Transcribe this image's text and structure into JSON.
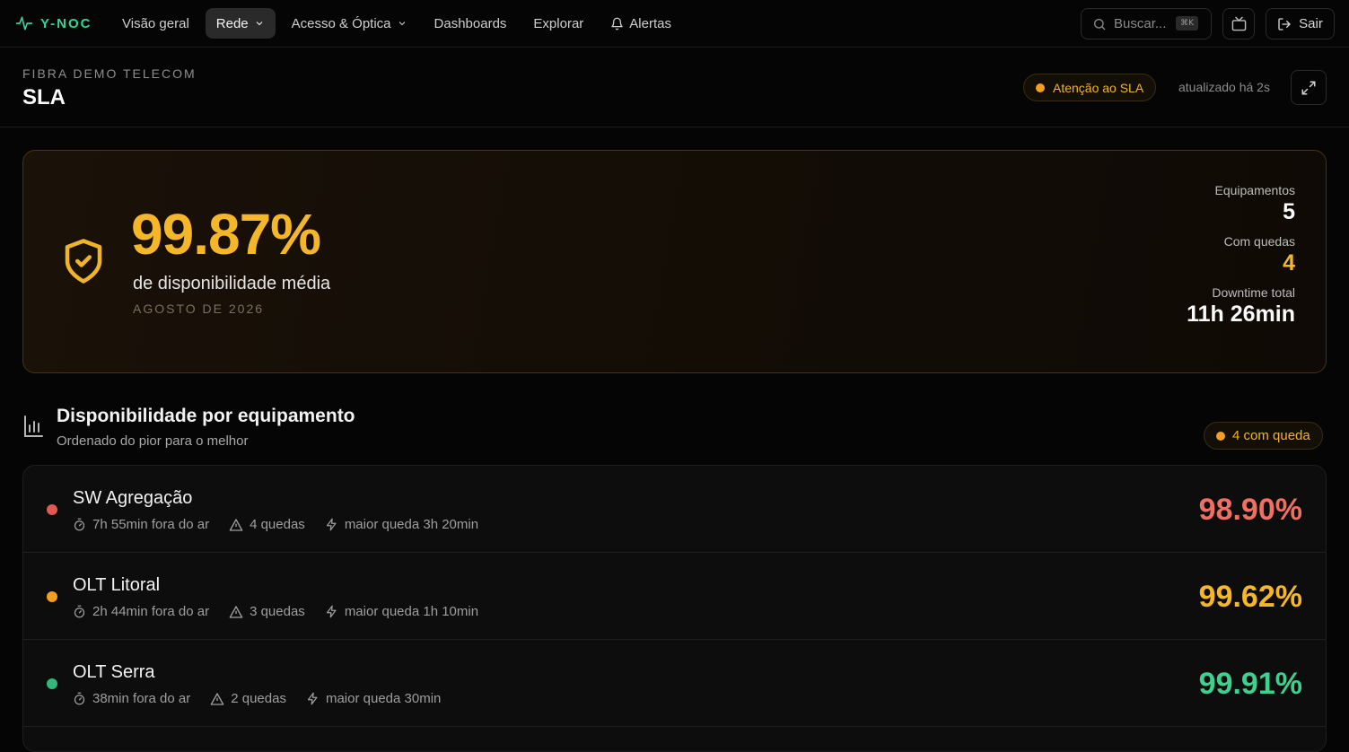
{
  "brand": {
    "name": "Y-NOC",
    "accent": "#34d399"
  },
  "nav": {
    "items": [
      {
        "label": "Visão geral",
        "active": false,
        "dropdown": false
      },
      {
        "label": "Rede",
        "active": true,
        "dropdown": true
      },
      {
        "label": "Acesso & Óptica",
        "active": false,
        "dropdown": true
      },
      {
        "label": "Dashboards",
        "active": false,
        "dropdown": false
      },
      {
        "label": "Explorar",
        "active": false,
        "dropdown": false
      },
      {
        "label": "Alertas",
        "active": false,
        "dropdown": false,
        "icon": "bell-icon"
      }
    ],
    "search_placeholder": "Buscar...",
    "search_shortcut": "⌘K",
    "logout_label": "Sair"
  },
  "header": {
    "org": "FIBRA DEMO TELECOM",
    "title": "SLA",
    "status_badge": "Atenção ao SLA",
    "updated": "atualizado há 2s"
  },
  "hero": {
    "availability": "99.87%",
    "subtitle": "de disponibilidade média",
    "period": "AGOSTO DE 2026",
    "stats": {
      "equipment_label": "Equipamentos",
      "equipment_value": "5",
      "outages_label": "Com quedas",
      "outages_value": "4",
      "downtime_label": "Downtime total",
      "downtime_value": "11h 26min"
    }
  },
  "section": {
    "title": "Disponibilidade por equipamento",
    "subtitle": "Ordenado do pior para o melhor",
    "badge": "4 com queda"
  },
  "equipment": [
    {
      "name": "SW Agregação",
      "downtime": "7h 55min fora do ar",
      "outages": "4 quedas",
      "longest": "maior queda 3h 20min",
      "availability": "98.90%",
      "color": "#e05a4f",
      "pct_color": "#ef6f63"
    },
    {
      "name": "OLT Litoral",
      "downtime": "2h 44min fora do ar",
      "outages": "3 quedas",
      "longest": "maior queda 1h 10min",
      "availability": "99.62%",
      "color": "#f0a023",
      "pct_color": "#f5b72a"
    },
    {
      "name": "OLT Serra",
      "downtime": "38min fora do ar",
      "outages": "2 quedas",
      "longest": "maior queda 30min",
      "availability": "99.91%",
      "color": "#34b87a",
      "pct_color": "#3fcf8e"
    }
  ],
  "colors": {
    "warning": "#f0b429",
    "danger": "#ef6f63",
    "ok": "#3fcf8e"
  }
}
